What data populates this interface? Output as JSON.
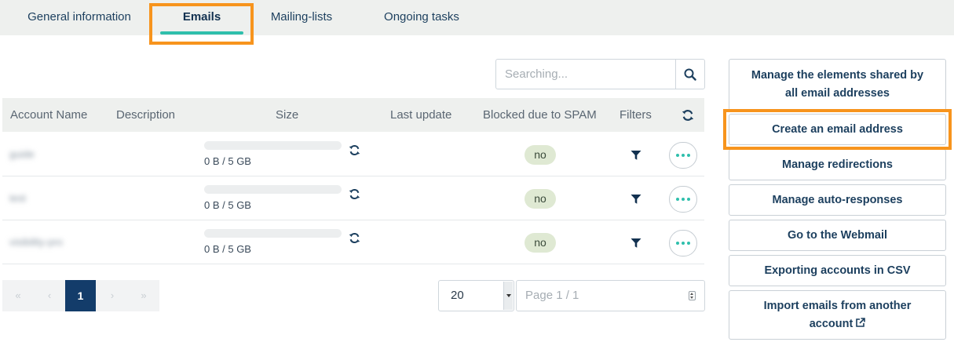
{
  "tabs": [
    {
      "label": "General information"
    },
    {
      "label": "Emails"
    },
    {
      "label": "Mailing-lists"
    },
    {
      "label": "Ongoing tasks"
    }
  ],
  "search": {
    "placeholder": "Searching..."
  },
  "table": {
    "headers": {
      "account_name": "Account Name",
      "description": "Description",
      "size": "Size",
      "last_update": "Last update",
      "blocked_spam": "Blocked due to SPAM",
      "filters": "Filters"
    },
    "rows": [
      {
        "account": "guide",
        "size": "0 B / 5 GB",
        "usage_fraction": 0,
        "spam": "no"
      },
      {
        "account": "test",
        "size": "0 B / 5 GB",
        "usage_fraction": 0,
        "spam": "no"
      },
      {
        "account": "visibility-pro",
        "size": "0 B / 5 GB",
        "usage_fraction": 0,
        "spam": "no"
      }
    ]
  },
  "pagination": {
    "first": "«",
    "prev": "‹",
    "current": "1",
    "next": "›",
    "last": "»",
    "per_page": "20",
    "page_info": "Page 1 / 1"
  },
  "sidebar": {
    "buttons": [
      {
        "label": "Manage the elements shared by all email addresses"
      },
      {
        "label": "Create an email address"
      },
      {
        "label": "Manage redirections"
      },
      {
        "label": "Manage auto-responses"
      },
      {
        "label": "Go to the Webmail"
      },
      {
        "label": "Exporting accounts in CSV"
      },
      {
        "label": "Import emails from another account"
      }
    ]
  },
  "colors": {
    "accent": "#2fbfac",
    "highlight": "#f7941d",
    "primary": "#133c6a",
    "spam_badge": "#dfe9d3"
  },
  "icons": {
    "search": "search-icon",
    "refresh": "refresh-icon",
    "filter": "filter-icon",
    "more": "more-options-icon",
    "external": "external-link-icon"
  }
}
